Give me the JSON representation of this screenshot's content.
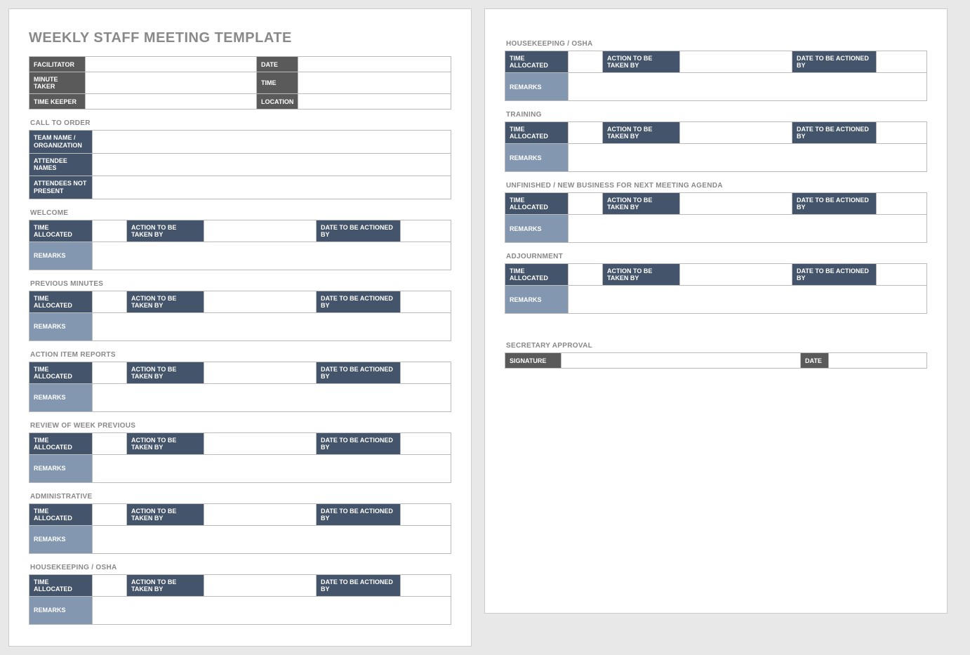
{
  "title": "WEEKLY STAFF MEETING TEMPLATE",
  "header": {
    "facilitator": "FACILITATOR",
    "minute_taker": "MINUTE TAKER",
    "time_keeper": "TIME KEEPER",
    "date": "DATE",
    "time": "TIME",
    "location": "LOCATION"
  },
  "call_to_order": {
    "section": "CALL TO ORDER",
    "team_name": "TEAM NAME / ORGANIZATION",
    "attendee_names": "ATTENDEE NAMES",
    "attendees_not_present": "ATTENDEES NOT PRESENT"
  },
  "labels": {
    "time_allocated": "TIME ALLOCATED",
    "action_by": "ACTION TO BE TAKEN BY",
    "date_by": "DATE TO BE ACTIONED BY",
    "remarks": "REMARKS"
  },
  "agenda_page1": [
    {
      "title": "WELCOME"
    },
    {
      "title": "PREVIOUS MINUTES"
    },
    {
      "title": "ACTION ITEM REPORTS"
    },
    {
      "title": "REVIEW OF WEEK PREVIOUS"
    },
    {
      "title": "ADMINISTRATIVE"
    },
    {
      "title": "HOUSEKEEPING / OSHA"
    }
  ],
  "agenda_page2": [
    {
      "title": "HOUSEKEEPING / OSHA"
    },
    {
      "title": "TRAINING"
    },
    {
      "title": "UNFINISHED / NEW BUSINESS FOR NEXT MEETING AGENDA"
    },
    {
      "title": "ADJOURNMENT"
    }
  ],
  "approval": {
    "section": "SECRETARY APPROVAL",
    "signature": "SIGNATURE",
    "date": "DATE"
  }
}
